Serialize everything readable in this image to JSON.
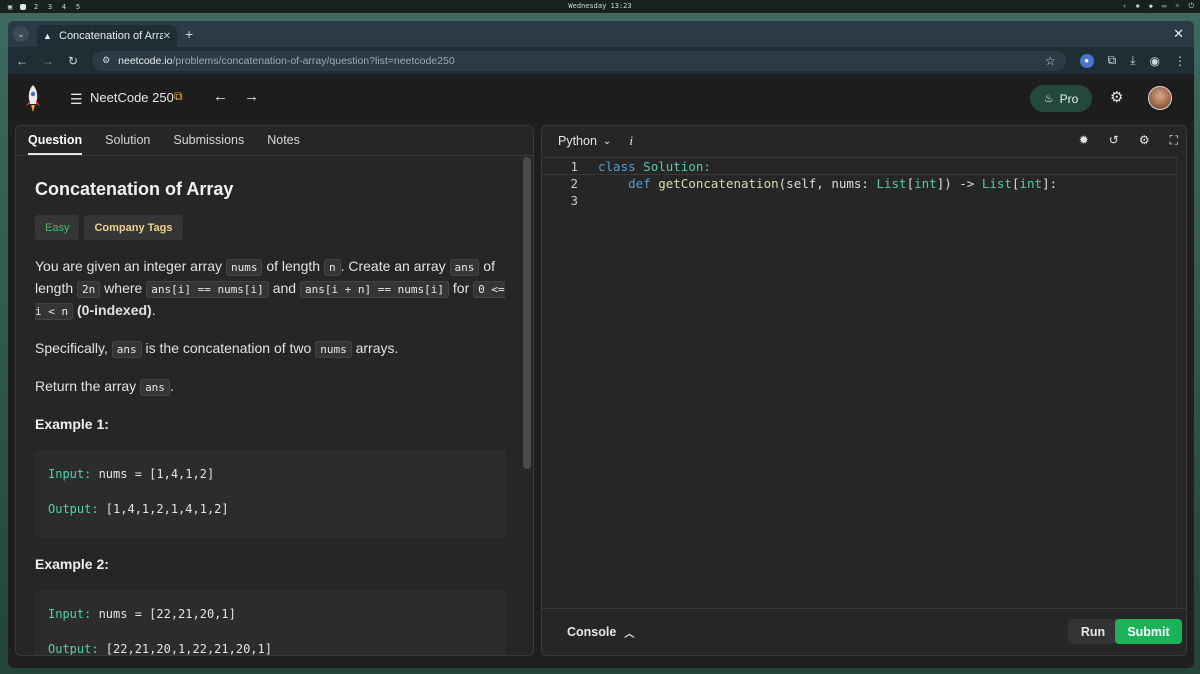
{
  "os": {
    "workspaces": [
      "2",
      "3",
      "4",
      "5"
    ],
    "clock": "Wednesday 13:23"
  },
  "browser": {
    "tab_title": "Concatenation of Array",
    "url_host": "neetcode.io",
    "url_path": "/problems/concatenation-of-array/question?list=neetcode250"
  },
  "site": {
    "list_name": "NeetCode 250",
    "pro_label": "Pro"
  },
  "left_tabs": [
    "Question",
    "Solution",
    "Submissions",
    "Notes"
  ],
  "problem": {
    "title": "Concatenation of Array",
    "difficulty": "Easy",
    "company_tags": "Company Tags",
    "p1": {
      "t1": "You are given an integer array ",
      "c1": "nums",
      "t2": " of length ",
      "c2": "n",
      "t3": ". Create an array ",
      "c3": "ans",
      "t4": " of length ",
      "c4": "2n",
      "t5": " where ",
      "c5": "ans[i] == nums[i]",
      "t6": " and ",
      "c6": "ans[i + n] == nums[i]",
      "t7": " for ",
      "c7": "0 <= i < n",
      "t8": " ",
      "b1": "(0-indexed)",
      "t9": "."
    },
    "p2": {
      "t1": "Specifically, ",
      "c1": "ans",
      "t2": " is the concatenation of two ",
      "c2": "nums",
      "t3": " arrays."
    },
    "p3": {
      "t1": "Return the array ",
      "c1": "ans",
      "t2": "."
    },
    "examples": [
      {
        "heading": "Example 1:",
        "input_label": "Input:",
        "input_value": " nums = [1,4,1,2]",
        "output_label": "Output:",
        "output_value": " [1,4,1,2,1,4,1,2]"
      },
      {
        "heading": "Example 2:",
        "input_label": "Input:",
        "input_value": " nums = [22,21,20,1]",
        "output_label": "Output:",
        "output_value": " [22,21,20,1,22,21,20,1]"
      }
    ]
  },
  "editor": {
    "language": "Python",
    "info_label": "i",
    "line_numbers": [
      "1",
      "2",
      "3"
    ],
    "code": {
      "l1_kw": "class",
      "l1_sp": " ",
      "l1_cls": "Solution",
      "l1_end": ":",
      "l2_indent": "    ",
      "l2_kw": "def",
      "l2_sp": " ",
      "l2_fn": "getConcatenation",
      "l2_p1": "(self, nums: ",
      "l2_t1": "List",
      "l2_b1": "[",
      "l2_t2": "int",
      "l2_b2": "]) -> ",
      "l2_t3": "List",
      "l2_b3": "[",
      "l2_t4": "int",
      "l2_b4": "]:"
    }
  },
  "console": {
    "label": "Console",
    "run": "Run",
    "submit": "Submit"
  },
  "colors": {
    "accent_green": "#1bb35a",
    "easy_green": "#3fbf73",
    "company_yellow": "#f0d08a"
  }
}
